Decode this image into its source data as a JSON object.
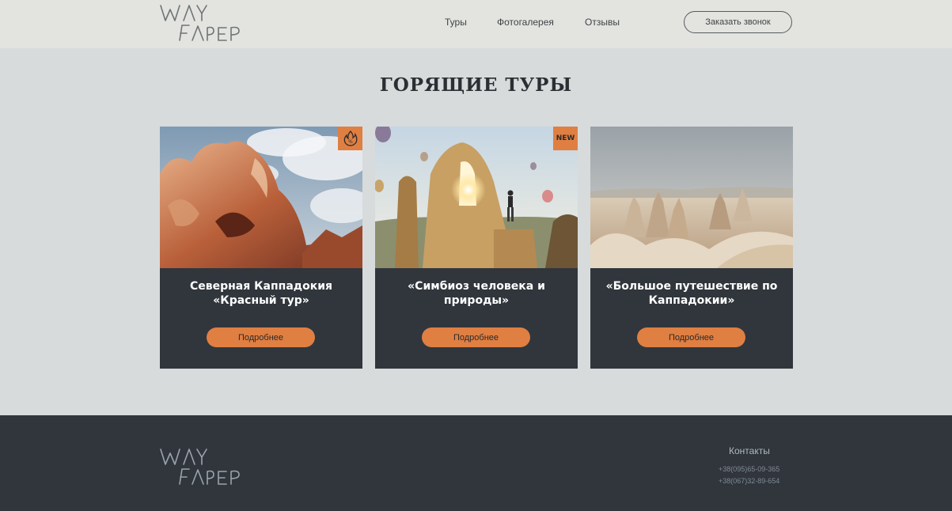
{
  "header": {
    "logo": {
      "line1": "WAY",
      "line2": "fArEr"
    },
    "nav": [
      {
        "label": "Туры"
      },
      {
        "label": "Фотогалерея"
      },
      {
        "label": "Отзывы"
      }
    ],
    "call_button": "Заказать звонок"
  },
  "main": {
    "title": "ГОРЯЩИЕ ТУРЫ",
    "cards": [
      {
        "title": "Северная Каппадокия «Красный тур»",
        "button": "Подробнее",
        "badge_icon": "fire-icon",
        "image": "red-rock-formation-photo"
      },
      {
        "title": "«Симбиоз человека и природы»",
        "button": "Подробнее",
        "badge_text": "NEW",
        "image": "rock-arch-balloons-photo"
      },
      {
        "title": "«Большое путешествие по Каппадокии»",
        "button": "Подробнее",
        "image": "fairy-chimneys-valley-photo"
      }
    ]
  },
  "footer": {
    "logo": {
      "line1": "WAY",
      "line2": "fArEr"
    },
    "contacts_title": "Контакты",
    "phones": [
      "+38(095)65-09-365",
      "+38(067)32-89-654"
    ]
  },
  "colors": {
    "header_bg": "#e3e4df",
    "page_bg": "#d7dbdc",
    "dark": "#30363c",
    "accent": "#e07f42"
  }
}
